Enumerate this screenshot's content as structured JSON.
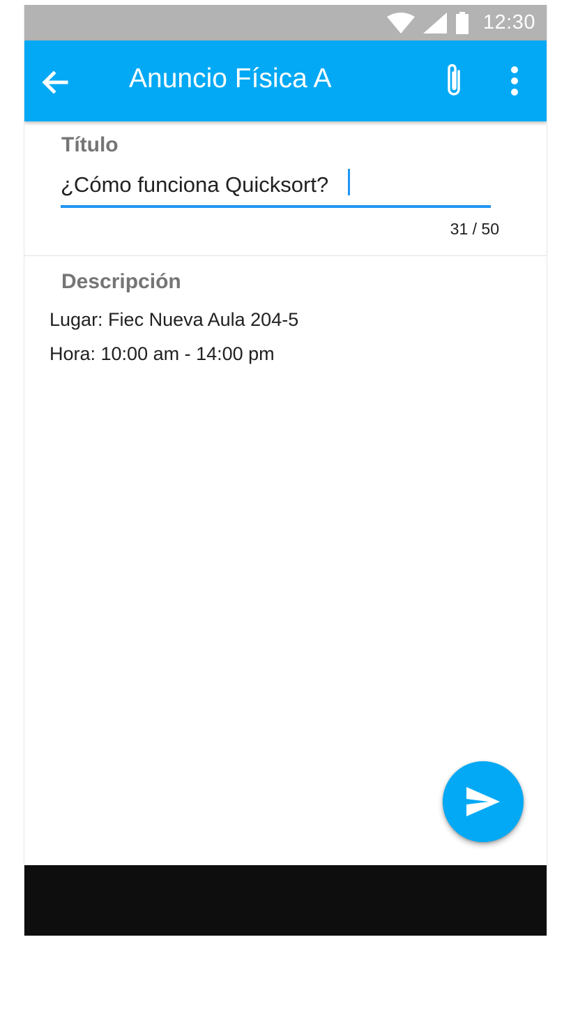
{
  "status_bar": {
    "time": "12:30",
    "icons": [
      "wifi-icon",
      "signal-icon",
      "battery-icon"
    ]
  },
  "app_bar": {
    "title": "Anuncio Física A",
    "back_icon": "arrow-back-icon",
    "attach_icon": "paperclip-icon",
    "more_icon": "more-vert-icon"
  },
  "form": {
    "title_label": "Título",
    "title_value": "¿Cómo funciona Quicksort?",
    "char_counter": "31 / 50",
    "description_label": "Descripción",
    "description_lines": [
      "Lugar: Fiec Nueva Aula 204-5",
      "Hora: 10:00 am - 14:00 pm"
    ]
  },
  "fab": {
    "icon": "send-icon"
  },
  "colors": {
    "primary": "#03a9f4",
    "accent": "#2196f3",
    "status_bar": "#b3b3b3",
    "nav_bar": "#0e0e0e",
    "label": "#757575"
  }
}
